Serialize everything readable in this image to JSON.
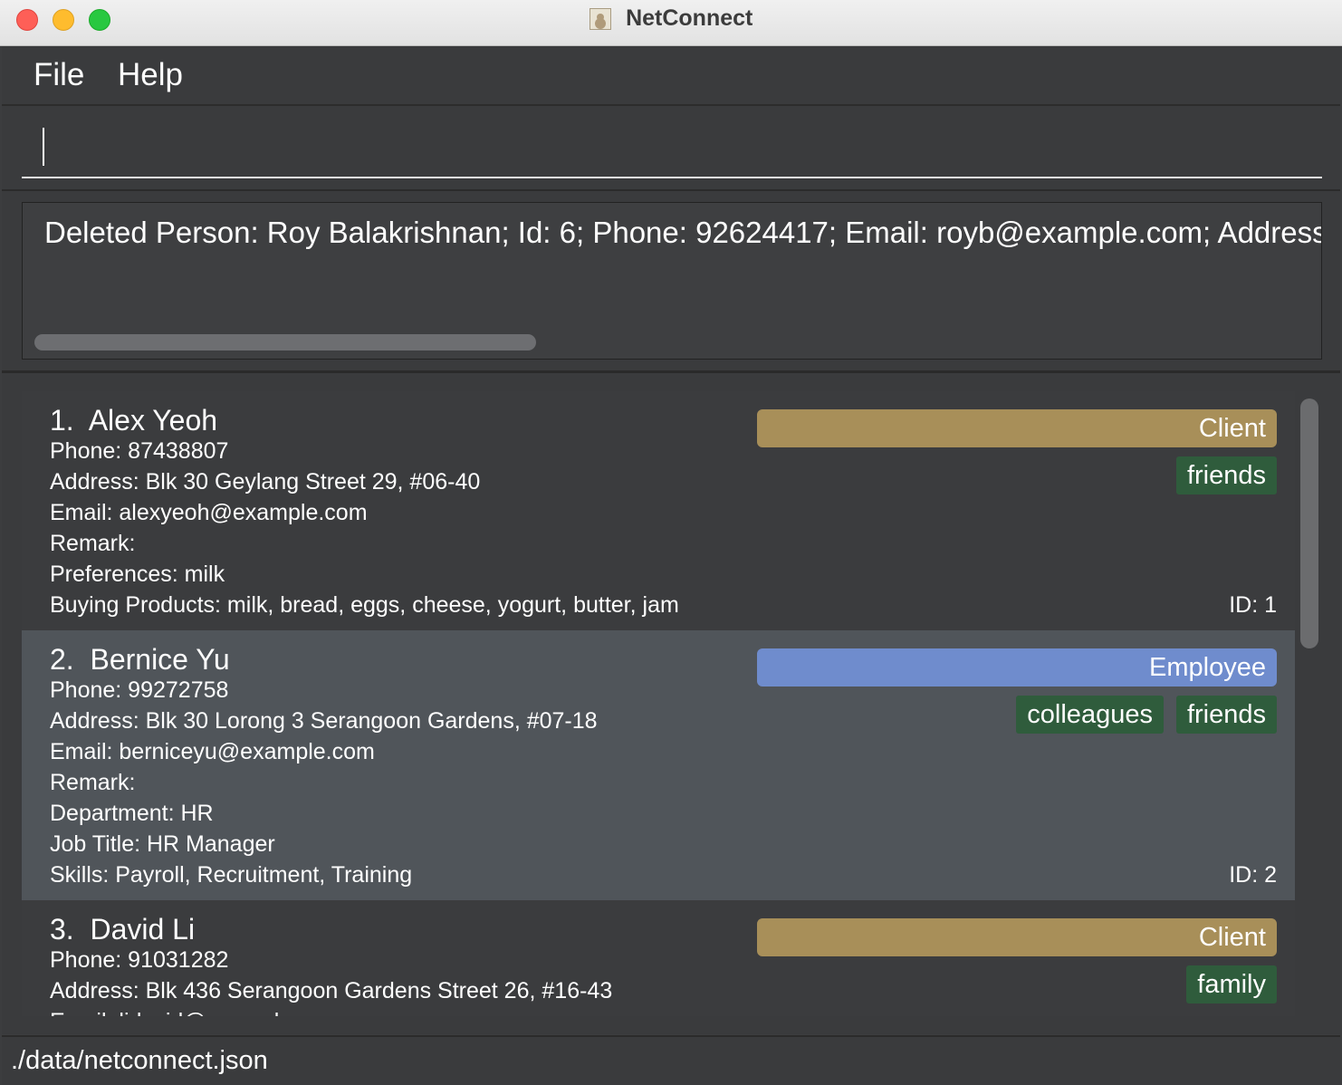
{
  "window": {
    "title": "NetConnect"
  },
  "menu": {
    "file": "File",
    "help": "Help"
  },
  "command": {
    "value": ""
  },
  "result": {
    "text": "Deleted Person: Roy Balakrishnan; Id: 6; Phone: 92624417; Email: royb@example.com; Address: B"
  },
  "persons": [
    {
      "index": "1.",
      "name": "Alex Yeoh",
      "phone": "Phone: 87438807",
      "address": "Address: Blk 30 Geylang Street 29, #06-40",
      "email": "Email: alexyeoh@example.com",
      "remark": "Remark:",
      "extra1": "Preferences: milk",
      "extra2": "Buying Products: milk, bread, eggs, cheese, yogurt, butter, jam",
      "role": "Client",
      "tags": [
        "friends"
      ],
      "id": "ID: 1"
    },
    {
      "index": "2.",
      "name": "Bernice Yu",
      "phone": "Phone: 99272758",
      "address": "Address: Blk 30 Lorong 3 Serangoon Gardens, #07-18",
      "email": "Email: berniceyu@example.com",
      "remark": "Remark:",
      "extra1": "Department: HR",
      "extra2": "Job Title: HR Manager",
      "extra3": "Skills: Payroll, Recruitment, Training",
      "role": "Employee",
      "tags": [
        "colleagues",
        "friends"
      ],
      "id": "ID: 2"
    },
    {
      "index": "3.",
      "name": "David Li",
      "phone": "Phone: 91031282",
      "address": "Address: Blk 436 Serangoon Gardens Street 26, #16-43",
      "email": "Email: lidavid@example.com",
      "role": "Client",
      "tags": [
        "family"
      ]
    }
  ],
  "status": {
    "path": "./data/netconnect.json"
  },
  "colors": {
    "client": "#a88f59",
    "employee": "#6f8ccd",
    "tag": "#2f5c3c",
    "selected_card": "#50555a"
  }
}
